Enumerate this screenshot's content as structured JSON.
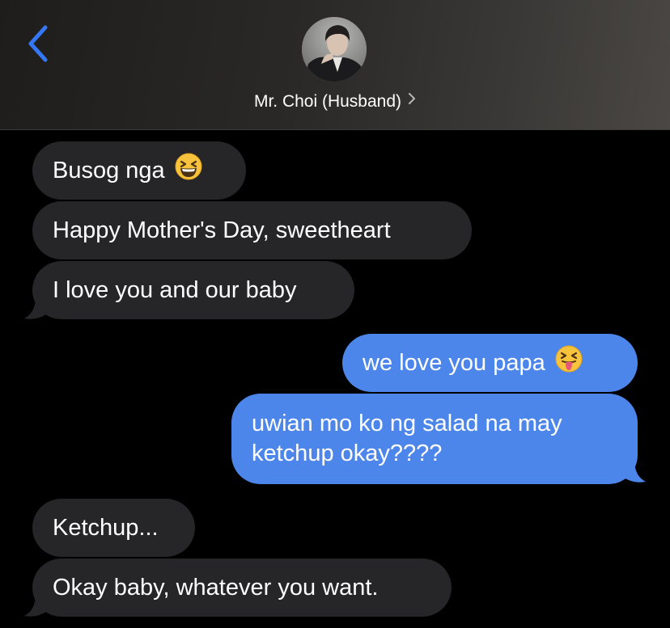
{
  "header": {
    "back_icon": "chevron-left-icon",
    "contact_name": "Mr. Choi (Husband)",
    "disclosure_icon": "chevron-right-icon",
    "accent": "#3478f6"
  },
  "messages": [
    {
      "direction": "incoming",
      "text": "Busog nga",
      "emoji": "grinning-squinting-face"
    },
    {
      "direction": "incoming",
      "text": "Happy Mother's Day, sweetheart"
    },
    {
      "direction": "incoming",
      "text": "I love you and our baby"
    },
    {
      "direction": "outgoing",
      "text": "we love you papa",
      "emoji": "squinting-face-with-tongue"
    },
    {
      "direction": "outgoing",
      "text": "uwian mo ko ng salad na may ketchup okay????"
    },
    {
      "direction": "incoming",
      "text": "Ketchup..."
    },
    {
      "direction": "incoming",
      "text": "Okay baby, whatever you want."
    }
  ],
  "colors": {
    "incoming_bubble": "#262629",
    "outgoing_bubble": "#4d86ea",
    "background": "#000000"
  }
}
